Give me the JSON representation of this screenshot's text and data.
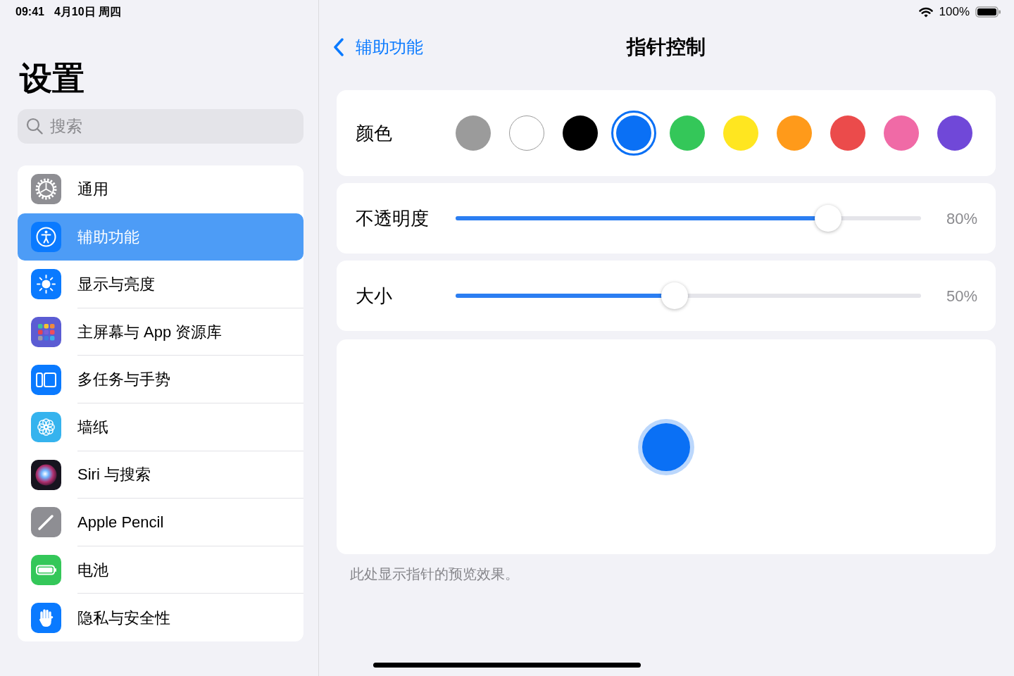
{
  "status_bar": {
    "time": "09:41",
    "date": "4月10日 周四",
    "battery": "100%"
  },
  "sidebar": {
    "title": "设置",
    "search": {
      "placeholder": "搜索"
    },
    "items": [
      {
        "label": "通用",
        "kind": "general",
        "selected": false
      },
      {
        "label": "辅助功能",
        "kind": "accessibility",
        "selected": true
      },
      {
        "label": "显示与亮度",
        "kind": "display",
        "selected": false
      },
      {
        "label": "主屏幕与 App 资源库",
        "kind": "homescreen",
        "selected": false
      },
      {
        "label": "多任务与手势",
        "kind": "multitasking",
        "selected": false
      },
      {
        "label": "墙纸",
        "kind": "wallpaper",
        "selected": false
      },
      {
        "label": "Siri 与搜索",
        "kind": "siri",
        "selected": false
      },
      {
        "label": "Apple Pencil",
        "kind": "pencil",
        "selected": false
      },
      {
        "label": "电池",
        "kind": "battery",
        "selected": false
      },
      {
        "label": "隐私与安全性",
        "kind": "privacy",
        "selected": false
      }
    ]
  },
  "nav_bar": {
    "back": "辅助功能",
    "title": "指针控制"
  },
  "color": {
    "label": "颜色",
    "swatches": [
      {
        "color": "#9b9b9b",
        "selected": false
      },
      {
        "color": "#ffffff",
        "selected": false
      },
      {
        "color": "#000000",
        "selected": false
      },
      {
        "color": "#0a70f5",
        "selected": true
      },
      {
        "color": "#34c759",
        "selected": false
      },
      {
        "color": "#ffe620",
        "selected": false
      },
      {
        "color": "#ff9a1a",
        "selected": false
      },
      {
        "color": "#eb4b4b",
        "selected": false
      },
      {
        "color": "#f06aa6",
        "selected": false
      },
      {
        "color": "#7048d8",
        "selected": false
      }
    ]
  },
  "sliders": [
    {
      "label": "不透明度",
      "level": 0.8,
      "reading": "80%"
    },
    {
      "label": "大小",
      "level": 0.47,
      "reading": "50%"
    }
  ],
  "preview": {
    "caption": "此处显示指针的预览效果。"
  }
}
